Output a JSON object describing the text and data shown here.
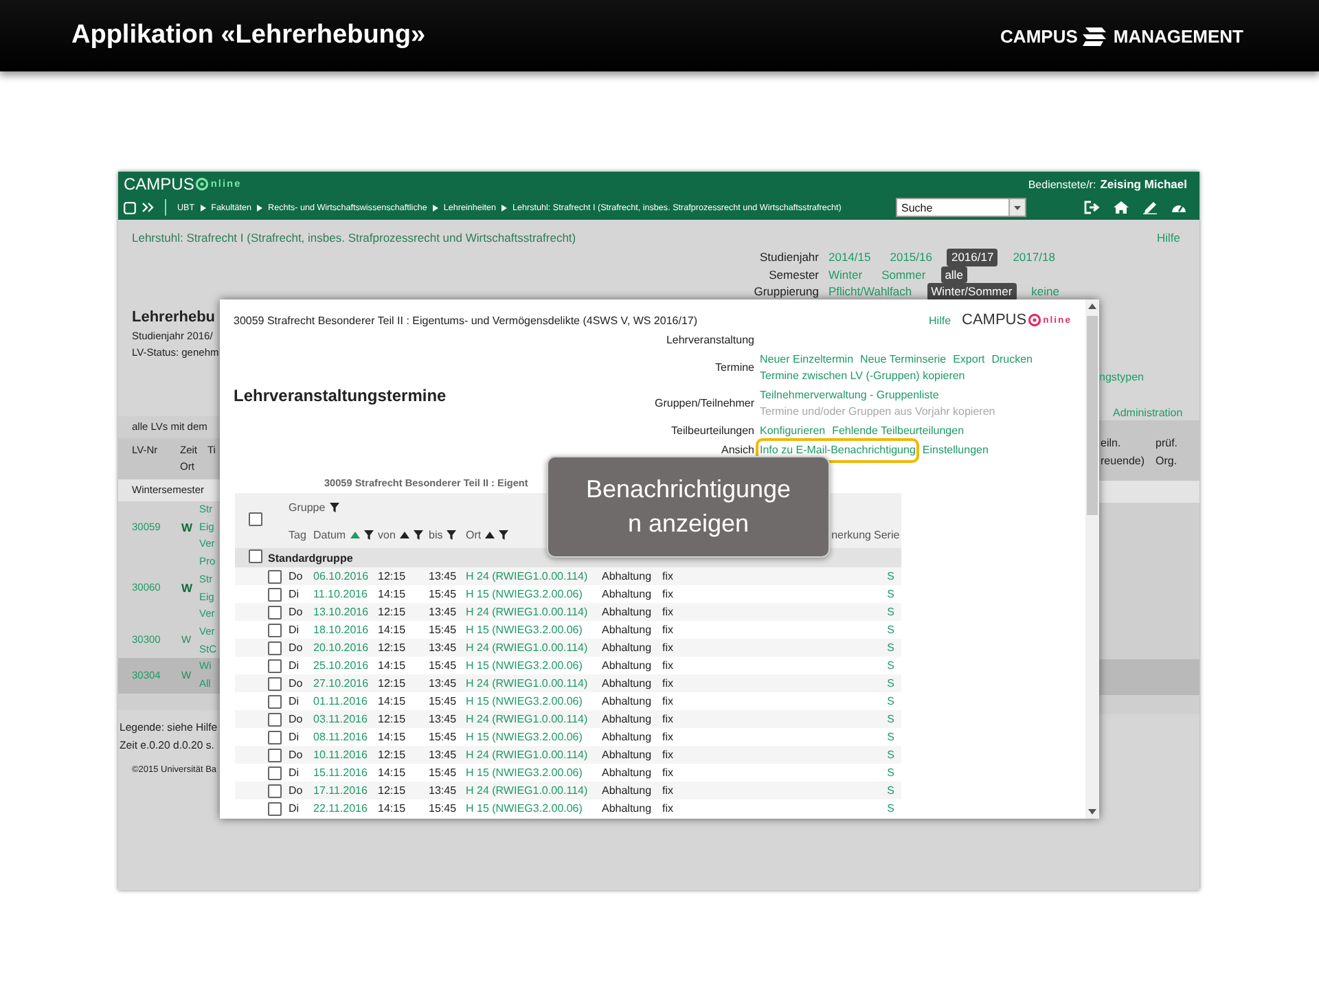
{
  "slide": {
    "title": "Applikation «Lehrerhebung»",
    "logo": {
      "left": "CAMPUS",
      "right": "MANAGEMENT"
    }
  },
  "topbar": {
    "brand": {
      "left": "CAMPUS",
      "right": "nline"
    },
    "user": {
      "label": "Bedienstete/r:",
      "name": "Zeising Michael"
    },
    "breadcrumb": [
      "UBT",
      "Fakultäten",
      "Rechts- und Wirtschaftswissenschaftliche",
      "Lehreinheiten",
      "Lehrstuhl: Strafrecht I (Strafrecht, insbes. Strafprozessrecht und Wirtschaftsstrafrecht)"
    ],
    "search": {
      "value": "Suche"
    }
  },
  "page": {
    "heading": "Lehrstuhl: Strafrecht I (Strafrecht, insbes. Strafprozessrecht und Wirtschaftsstrafrecht)",
    "help": "Hilfe",
    "filters": [
      {
        "label": "Studienjahr",
        "options": [
          {
            "label": "2014/15",
            "selected": false
          },
          {
            "label": "2015/16",
            "selected": false
          },
          {
            "label": "2016/17",
            "selected": true
          },
          {
            "label": "2017/18",
            "selected": false
          }
        ]
      },
      {
        "label": "Semester",
        "options": [
          {
            "label": "Winter",
            "selected": false
          },
          {
            "label": "Sommer",
            "selected": false
          },
          {
            "label": "alle",
            "selected": true
          }
        ]
      },
      {
        "label": "Gruppierung",
        "options": [
          {
            "label": "Pflicht/Wahlfach",
            "selected": false
          },
          {
            "label": "Winter/Sommer",
            "selected": true
          },
          {
            "label": "keine",
            "selected": false
          }
        ]
      }
    ],
    "left": {
      "title": "Lehrerhebu",
      "lines": [
        "Studienjahr 2016/",
        "LV-Status: genehm"
      ],
      "caption": "alle LVs mit dem",
      "columns": [
        {
          "label": "LV-Nr"
        },
        {
          "label": "Zeit",
          "sub": "Ort"
        },
        {
          "label": "Ti"
        }
      ],
      "section": "Wintersemester",
      "rows": [
        {
          "number": "30059",
          "term": "W",
          "bold": true,
          "highlighted": false,
          "title_lines": [
            "Str",
            "Eig",
            "Ver"
          ]
        },
        {
          "number": "30060",
          "term": "W",
          "bold": true,
          "highlighted": false,
          "title_lines": [
            "Pro",
            "Str",
            "Eig",
            "Ver"
          ]
        },
        {
          "number": "30300",
          "term": "W",
          "bold": false,
          "highlighted": false,
          "title_lines": [
            "Ver",
            "StC"
          ]
        },
        {
          "number": "30304",
          "term": "W",
          "bold": false,
          "highlighted": true,
          "title_lines": [
            "Wi",
            "All"
          ]
        }
      ],
      "legend": [
        "Legende: siehe Hilfe",
        "Zeit e.0.20 d.0.20 s."
      ],
      "copyright": "©2015 Universität Ba"
    },
    "right": {
      "links": [
        "ngstypen",
        "Administration"
      ],
      "columns": [
        {
          "label": "eiln.",
          "sub": "reuende)"
        },
        {
          "label": "prüf.",
          "sub": "Org."
        }
      ]
    }
  },
  "dialog": {
    "title": "30059 Strafrecht Besonderer Teil II : Eigentums- und Vermögensdelikte (4SWS V, WS 2016/17)",
    "help": "Hilfe",
    "brand": {
      "left": "CAMPUS",
      "right": "nline"
    },
    "heading": "Lehrveranstaltungstermine",
    "actions": [
      {
        "label": "Lehrveranstaltung"
      },
      {
        "label": "Termine",
        "lines": [
          [
            {
              "text": "Neuer Einzeltermin",
              "disabled": false,
              "highlighted": false
            },
            {
              "text": "Neue Terminserie",
              "disabled": false,
              "highlighted": false
            },
            {
              "text": "Export",
              "disabled": false,
              "highlighted": false
            },
            {
              "text": "Drucken",
              "disabled": false,
              "highlighted": false
            }
          ],
          [
            {
              "text": "Termine zwischen LV (-Gruppen) kopieren",
              "disabled": false,
              "highlighted": false
            }
          ]
        ]
      },
      {
        "label": "Gruppen/Teilnehmer",
        "lines": [
          [
            {
              "text": "Teilnehmerverwaltung - Gruppenliste",
              "disabled": false,
              "highlighted": false
            }
          ],
          [
            {
              "text": "Termine und/oder Gruppen aus Vorjahr kopieren",
              "disabled": true,
              "highlighted": false
            }
          ]
        ]
      },
      {
        "label": "Teilbeurteilungen",
        "lines": [
          [
            {
              "text": "Konfigurieren",
              "disabled": false,
              "highlighted": false
            },
            {
              "text": "Fehlende Teilbeurteilungen",
              "disabled": false,
              "highlighted": false
            }
          ]
        ]
      },
      {
        "label": "Ansich",
        "lines": [
          [
            {
              "text": "Info zu E-Mail-Benachrichtigung",
              "disabled": false,
              "highlighted": true
            },
            {
              "text": "Einstellungen",
              "disabled": false,
              "highlighted": false
            }
          ]
        ]
      }
    ],
    "table": {
      "subtitle": "30059 Strafrecht Besonderer Teil II : Eigent",
      "select_all": {
        "checked": false
      },
      "group_label": "Gruppe",
      "columns": [
        {
          "label": "Tag",
          "sortable": false,
          "filterable": false
        },
        {
          "label": "Datum",
          "sortable": true,
          "sorted": true,
          "filterable": true
        },
        {
          "label": "von",
          "sortable": true,
          "sorted": false,
          "filterable": true
        },
        {
          "label": "bis",
          "sortable": false,
          "filterable": true
        },
        {
          "label": "Ort",
          "sortable": true,
          "sorted": false,
          "filterable": true
        },
        {
          "label": "nerkung",
          "sortable": false,
          "filterable": false
        },
        {
          "label": "Serie",
          "sortable": false,
          "filterable": false
        }
      ],
      "group": {
        "name": "Standardgruppe",
        "checked": false
      },
      "rows": [
        {
          "checked": false,
          "day": "Do",
          "date": "06.10.2016",
          "from": "12:15",
          "to": "13:45",
          "room": "H 24 (RWIEG1.0.00.114)",
          "type": "Abhaltung",
          "status": "fix",
          "series": "S"
        },
        {
          "checked": false,
          "day": "Di",
          "date": "11.10.2016",
          "from": "14:15",
          "to": "15:45",
          "room": "H 15 (NWIEG3.2.00.06)",
          "type": "Abhaltung",
          "status": "fix",
          "series": "S"
        },
        {
          "checked": false,
          "day": "Do",
          "date": "13.10.2016",
          "from": "12:15",
          "to": "13:45",
          "room": "H 24 (RWIEG1.0.00.114)",
          "type": "Abhaltung",
          "status": "fix",
          "series": "S"
        },
        {
          "checked": false,
          "day": "Di",
          "date": "18.10.2016",
          "from": "14:15",
          "to": "15:45",
          "room": "H 15 (NWIEG3.2.00.06)",
          "type": "Abhaltung",
          "status": "fix",
          "series": "S"
        },
        {
          "checked": false,
          "day": "Do",
          "date": "20.10.2016",
          "from": "12:15",
          "to": "13:45",
          "room": "H 24 (RWIEG1.0.00.114)",
          "type": "Abhaltung",
          "status": "fix",
          "series": "S"
        },
        {
          "checked": false,
          "day": "Di",
          "date": "25.10.2016",
          "from": "14:15",
          "to": "15:45",
          "room": "H 15 (NWIEG3.2.00.06)",
          "type": "Abhaltung",
          "status": "fix",
          "series": "S"
        },
        {
          "checked": false,
          "day": "Do",
          "date": "27.10.2016",
          "from": "12:15",
          "to": "13:45",
          "room": "H 24 (RWIEG1.0.00.114)",
          "type": "Abhaltung",
          "status": "fix",
          "series": "S"
        },
        {
          "checked": false,
          "day": "Di",
          "date": "01.11.2016",
          "from": "14:15",
          "to": "15:45",
          "room": "H 15 (NWIEG3.2.00.06)",
          "type": "Abhaltung",
          "status": "fix",
          "series": "S"
        },
        {
          "checked": false,
          "day": "Do",
          "date": "03.11.2016",
          "from": "12:15",
          "to": "13:45",
          "room": "H 24 (RWIEG1.0.00.114)",
          "type": "Abhaltung",
          "status": "fix",
          "series": "S"
        },
        {
          "checked": false,
          "day": "Di",
          "date": "08.11.2016",
          "from": "14:15",
          "to": "15:45",
          "room": "H 15 (NWIEG3.2.00.06)",
          "type": "Abhaltung",
          "status": "fix",
          "series": "S"
        },
        {
          "checked": false,
          "day": "Do",
          "date": "10.11.2016",
          "from": "12:15",
          "to": "13:45",
          "room": "H 24 (RWIEG1.0.00.114)",
          "type": "Abhaltung",
          "status": "fix",
          "series": "S"
        },
        {
          "checked": false,
          "day": "Di",
          "date": "15.11.2016",
          "from": "14:15",
          "to": "15:45",
          "room": "H 15 (NWIEG3.2.00.06)",
          "type": "Abhaltung",
          "status": "fix",
          "series": "S"
        },
        {
          "checked": false,
          "day": "Do",
          "date": "17.11.2016",
          "from": "12:15",
          "to": "13:45",
          "room": "H 24 (RWIEG1.0.00.114)",
          "type": "Abhaltung",
          "status": "fix",
          "series": "S"
        },
        {
          "checked": false,
          "day": "Di",
          "date": "22.11.2016",
          "from": "14:15",
          "to": "15:45",
          "room": "H 15 (NWIEG3.2.00.06)",
          "type": "Abhaltung",
          "status": "fix",
          "series": "S"
        }
      ]
    }
  },
  "callout": {
    "text": "Benachrichtigunge\nn anzeigen"
  }
}
